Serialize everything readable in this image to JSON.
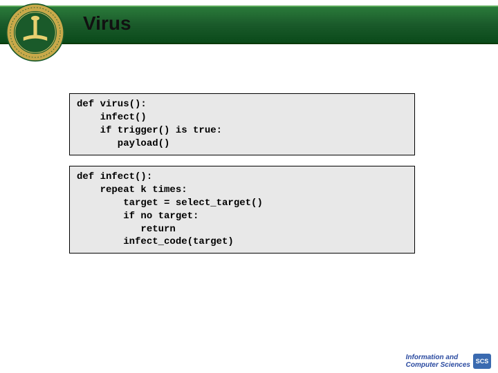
{
  "header": {
    "title": "Virus"
  },
  "code_block_1": "def virus():\n    infect()\n    if trigger() is true:\n       payload()",
  "code_block_2": "def infect():\n    repeat k times:\n        target = select_target()\n        if no target:\n           return\n        infect_code(target)",
  "footer": {
    "line1": "Information and",
    "line2": "Computer Sciences",
    "badge": "SCS"
  },
  "logo": {
    "outer_color": "#c8a94a",
    "inner_color": "#1a5a2a",
    "accent": "#e8d070"
  }
}
